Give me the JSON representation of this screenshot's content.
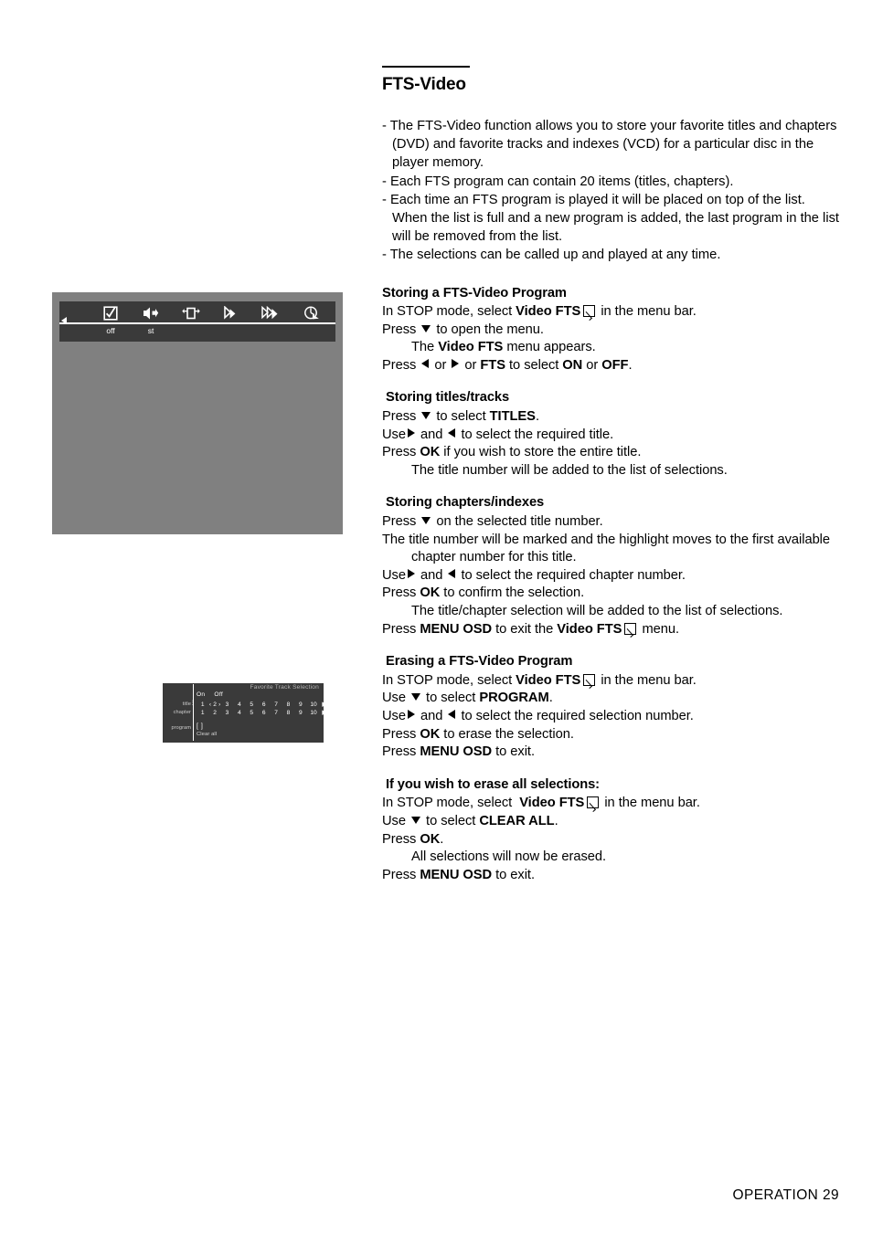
{
  "page": {
    "heading": "FTS-Video",
    "footer": "OPERATION 29"
  },
  "intro": {
    "bullets": [
      "- The FTS-Video function allows you to store your favorite titles and chapters (DVD) and favorite tracks and indexes (VCD) for a particular disc in the player memory.",
      "- Each FTS program can contain 20 items (titles, chapters).",
      "- Each time an FTS program is played it will be placed on top of the list. When the list is full and a new program is added, the last program in the list will be removed from the list.",
      "- The selections can be called up and played at any time."
    ]
  },
  "sections": {
    "storing_program": {
      "title": "Storing a FTS-Video Program",
      "l1_a": "In STOP mode, select",
      "l1_b": "Video FTS",
      "l1_c": "in the menu bar.",
      "l2_a": "Press",
      "l2_b": "to open the menu.",
      "l3_a": "The",
      "l3_b": "Video FTS",
      "l3_c": "menu appears.",
      "l4_a": "Press",
      "l4_b": "or",
      "l4_c": "or",
      "l4_d": "FTS",
      "l4_e": "to select",
      "l4_f": "ON",
      "l4_g": "or",
      "l4_h": "OFF",
      "l4_i": "."
    },
    "storing_titles": {
      "title": "Storing titles/tracks",
      "l1_a": "Press",
      "l1_b": "to select",
      "l1_c": "TITLES",
      "l1_d": ".",
      "l2_a": "Use",
      "l2_b": "and",
      "l2_c": "to select the required title.",
      "l3_a": "Press",
      "l3_b": "OK",
      "l3_c": "if you wish to store the entire title.",
      "l4": "The title number will be added to the list of selections."
    },
    "storing_chapters": {
      "title": "Storing chapters/indexes",
      "l1_a": "Press",
      "l1_b": "on the selected title number.",
      "l2": "The title number will be marked and the highlight moves to the first available chapter number for this title.",
      "l3_a": "Use",
      "l3_b": "and",
      "l3_c": "to select the required chapter number.",
      "l4_a": "Press",
      "l4_b": "OK",
      "l4_c": "to confirm the selection.",
      "l5": "The title/chapter selection will be added to the list of selections.",
      "l6_a": "Press",
      "l6_b": "MENU OSD",
      "l6_c": "to exit the",
      "l6_d": "Video FTS",
      "l6_e": "menu."
    },
    "erasing_program": {
      "title": "Erasing a FTS-Video Program",
      "l1_a": "In STOP mode, select",
      "l1_b": "Video FTS",
      "l1_c": "in the menu bar.",
      "l2_a": "Use",
      "l2_b": "to select",
      "l2_c": "PROGRAM",
      "l2_d": ".",
      "l3_a": "Use",
      "l3_b": "and",
      "l3_c": "to select the required selection number.",
      "l4_a": "Press",
      "l4_b": "OK",
      "l4_c": "to erase the selection.",
      "l5_a": "Press",
      "l5_b": "MENU OSD",
      "l5_c": "to exit."
    },
    "erase_all": {
      "title": "If you wish to erase all selections:",
      "l1_a": "In STOP mode, select",
      "l1_b": "Video FTS",
      "l1_c": "in the menu bar.",
      "l2_a": "Use",
      "l2_b": "to select",
      "l2_c": "CLEAR ALL",
      "l2_d": ".",
      "l3_a": "Press",
      "l3_b": "OK",
      "l3_c": ".",
      "l4": "All selections will now be erased.",
      "l5_a": "Press",
      "l5_b": "MENU OSD",
      "l5_c": "to exit."
    }
  },
  "tv_screen": {
    "background_color": "#808080",
    "bar_color": "#3a3a3a",
    "menu_bar": {
      "icons": [
        {
          "name": "fts-checkbox-icon",
          "label": "off"
        },
        {
          "name": "audio-speaker-icon",
          "label": "st"
        },
        {
          "name": "screen-fit-icon",
          "label": ""
        },
        {
          "name": "slow-motion-icon",
          "label": ""
        },
        {
          "name": "fast-scan-icon",
          "label": ""
        },
        {
          "name": "time-display-icon",
          "label": ""
        }
      ]
    },
    "osd": {
      "panel_title": "Favorite Track Selection",
      "on_label": "On",
      "off_label": "Off",
      "rows": [
        {
          "label": "title",
          "numbers": [
            "1",
            "2",
            "3",
            "4",
            "5",
            "6",
            "7",
            "8",
            "9",
            "10"
          ],
          "marked_index": 1,
          "arrow": "▶"
        },
        {
          "label": "chapter",
          "numbers": [
            "1",
            "2",
            "3",
            "4",
            "5",
            "6",
            "7",
            "8",
            "9",
            "10"
          ],
          "marked_index": -1,
          "arrow": "▶"
        }
      ],
      "program_label": "program",
      "program_value": "[ ]",
      "clear_all_label": "Clear all"
    }
  }
}
